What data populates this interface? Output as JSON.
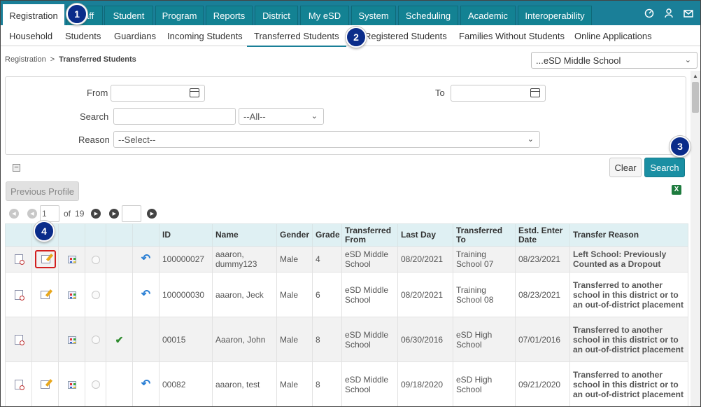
{
  "top_nav": {
    "tabs": [
      "Registration",
      "Staff",
      "Student",
      "Program",
      "Reports",
      "District",
      "My eSD",
      "System",
      "Scheduling",
      "Academic",
      "Interoperability"
    ],
    "icons": [
      "dashboard-icon",
      "user-icon",
      "mail-icon"
    ]
  },
  "sub_nav": {
    "tabs": [
      "Household",
      "Students",
      "Guardians",
      "Incoming Students",
      "Transferred Students",
      "Registered Students",
      "Families Without Students",
      "Online Applications"
    ],
    "active": "Transferred Students"
  },
  "badges": [
    "1",
    "2",
    "3",
    "4"
  ],
  "breadcrumb": {
    "root": "Registration",
    "separator": ">",
    "current": "Transferred Students"
  },
  "school_select": {
    "value": "...eSD Middle School"
  },
  "filters": {
    "from_label": "From",
    "to_label": "To",
    "search_label": "Search",
    "search_value": "",
    "search_scope": "--All--",
    "reason_label": "Reason",
    "reason_value": "--Select--"
  },
  "buttons": {
    "clear": "Clear",
    "search": "Search",
    "previous_profile": "Previous Profile"
  },
  "pager": {
    "page": "1",
    "of_label": "of",
    "total_pages": "19"
  },
  "table": {
    "columns": [
      "ID",
      "Name",
      "Gender",
      "Grade",
      "Transferred From",
      "Last Day",
      "Transferred To",
      "Estd. Enter Date",
      "Transfer Reason"
    ],
    "rows": [
      {
        "id": "100000027",
        "name": "aaaron, dummy123",
        "gender": "Male",
        "grade": "4",
        "from": "eSD Middle School",
        "last_day": "08/20/2021",
        "to": "Training School 07",
        "enter_date": "08/23/2021",
        "reason": "Left School: Previously Counted as a Dropout",
        "edit": true,
        "undo": true,
        "check": false
      },
      {
        "id": "100000030",
        "name": "aaaron, Jeck",
        "gender": "Male",
        "grade": "6",
        "from": "eSD Middle School",
        "last_day": "08/20/2021",
        "to": "Training School 08",
        "enter_date": "08/23/2021",
        "reason": "Transferred to another school in this district or to an out-of-district placement",
        "edit": true,
        "undo": true,
        "check": false
      },
      {
        "id": "00015",
        "name": "Aaaron, John",
        "gender": "Male",
        "grade": "8",
        "from": "eSD Middle School",
        "last_day": "06/30/2016",
        "to": "eSD High School",
        "enter_date": "07/01/2016",
        "reason": "Transferred to another school in this district or to an out-of-district placement",
        "edit": false,
        "undo": false,
        "check": true
      },
      {
        "id": "00082",
        "name": "aaaron, test",
        "gender": "Male",
        "grade": "8",
        "from": "eSD Middle School",
        "last_day": "09/18/2020",
        "to": "eSD High School",
        "enter_date": "09/21/2020",
        "reason": "Transferred to another school in this district or to an out-of-district placement",
        "edit": true,
        "undo": true,
        "check": false
      }
    ]
  }
}
